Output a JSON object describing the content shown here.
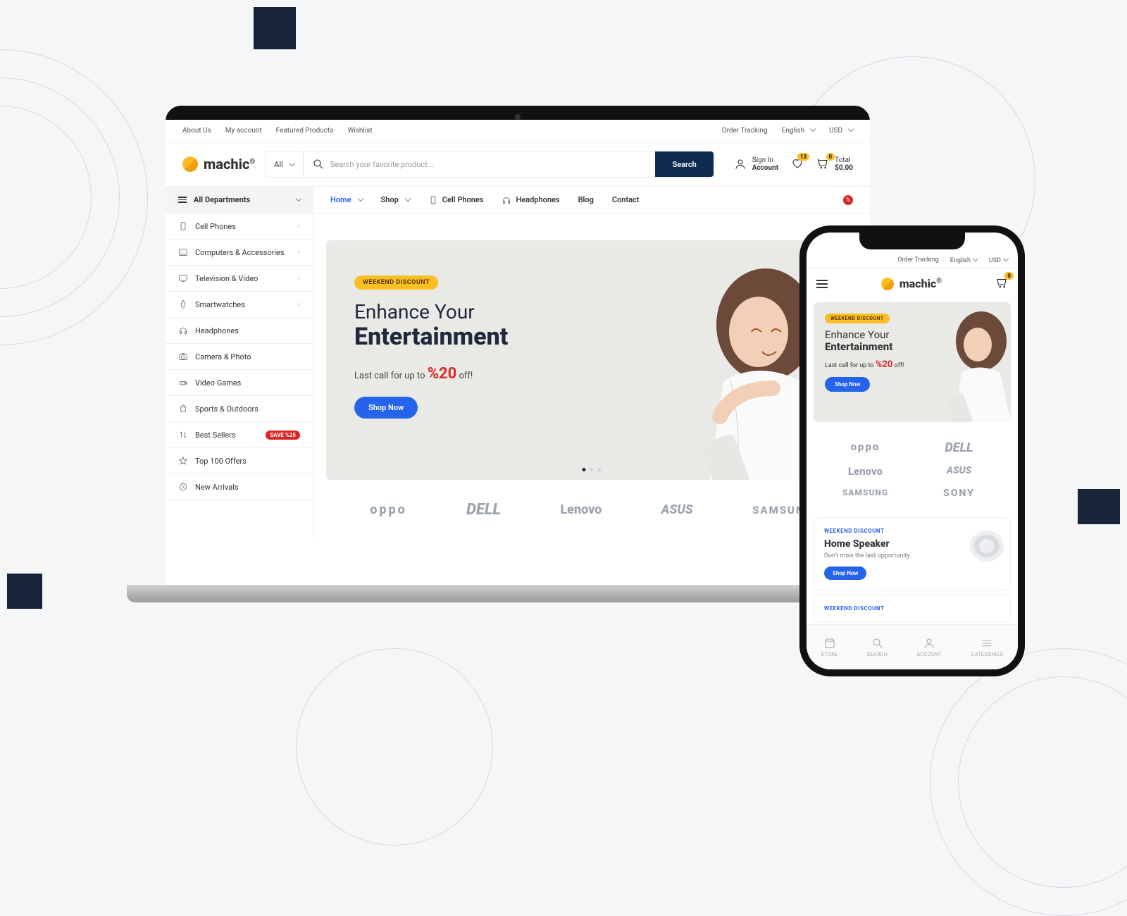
{
  "topbar": {
    "left": [
      "About Us",
      "My account",
      "Featured Products",
      "Wishlist"
    ],
    "order_tracking": "Order Tracking",
    "language": "English",
    "currency": "USD"
  },
  "logo": {
    "name": "machic",
    "reg": "®"
  },
  "search": {
    "category": "All",
    "placeholder": "Search your favorite product...",
    "button": "Search"
  },
  "account": {
    "top": "Sign In",
    "bottom": "Account"
  },
  "wishlist_count": "13",
  "cart": {
    "count": "0",
    "top": "Total",
    "amount": "$0.00"
  },
  "departments_label": "All Departments",
  "main_nav": [
    "Home",
    "Shop",
    "Cell Phones",
    "Headphones",
    "Blog",
    "Contact"
  ],
  "departments": [
    {
      "label": "Cell Phones",
      "caret": true
    },
    {
      "label": "Computers & Accessories",
      "caret": true
    },
    {
      "label": "Television & Video",
      "caret": true
    },
    {
      "label": "Smartwatches",
      "caret": true
    },
    {
      "label": "Headphones"
    },
    {
      "label": "Camera & Photo"
    },
    {
      "label": "Video Games"
    },
    {
      "label": "Sports & Outdoors"
    },
    {
      "label": "Best Sellers",
      "badge": "SAVE %25"
    },
    {
      "label": "Top 100 Offers"
    },
    {
      "label": "New Arrivals"
    }
  ],
  "hero": {
    "tag": "WEEKEND DISCOUNT",
    "line1": "Enhance Your",
    "line2": "Entertainment",
    "sub_pre": "Last call for up to ",
    "pct": "%20",
    "sub_post": " off!",
    "button": "Shop Now"
  },
  "brands": [
    "oppo",
    "DELL",
    "Lenovo",
    "ASUS",
    "SAMSUNG",
    "SONY"
  ],
  "mobile": {
    "cart_count": "0",
    "brands": [
      "oppo",
      "DELL",
      "Lenovo",
      "ASUS",
      "SAMSUNG",
      "SONY"
    ],
    "promo1": {
      "tag": "WEEKEND DISCOUNT",
      "title": "Home Speaker",
      "sub": "Don't miss the last opportunity.",
      "button": "Shop Now"
    },
    "promo2_tag": "WEEKEND DISCOUNT",
    "nav": [
      "STORE",
      "SEARCH",
      "ACCOUNT",
      "CATEGORIES"
    ]
  }
}
